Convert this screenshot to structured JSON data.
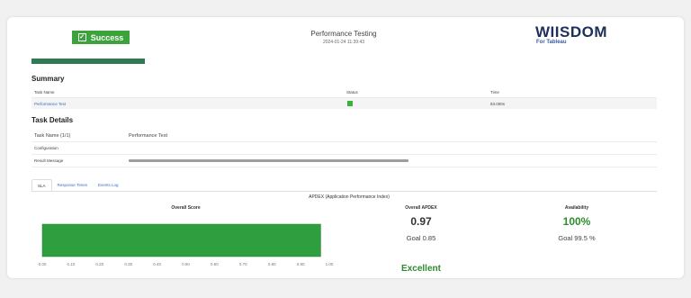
{
  "header": {
    "status_label": "Success",
    "title": "Performance Testing",
    "timestamp": "2024-01-24 11:39:43",
    "logo_main": "WIISDOM",
    "logo_sub": "For Tableau"
  },
  "summary": {
    "title": "Summary",
    "columns": [
      "Task Name",
      "Status",
      "Time"
    ],
    "row": {
      "task_name": "Performance Test",
      "status": "success",
      "time": "83.000s"
    }
  },
  "task_details": {
    "title": "Task Details",
    "task_name_label": "Task Name (1/1)",
    "task_name_value": "Performance Test",
    "configuration_label": "Configuration",
    "result_message_label": "Result Message"
  },
  "tabs": [
    {
      "label": "SLA",
      "active": true
    },
    {
      "label": "Response Times",
      "active": false
    },
    {
      "label": "Events Log",
      "active": false
    }
  ],
  "apdex": {
    "title": "APDEX (Application Performance Index)",
    "overall_apdex_label": "Overall APDEX",
    "overall_apdex_value": "0.97",
    "goal": "Goal 0.85",
    "rating": "Excellent",
    "availability_label": "Availability",
    "availability_value": "100%",
    "availability_goal": "Goal 99.5 %"
  },
  "chart_data": {
    "type": "bar",
    "orientation": "horizontal",
    "title": "Overall Score",
    "categories": [
      ""
    ],
    "values": [
      0.97
    ],
    "xlim": [
      0,
      1.0
    ],
    "xticks": [
      "0.00",
      "0.10",
      "0.20",
      "0.30",
      "0.40",
      "0.50",
      "0.60",
      "0.70",
      "0.80",
      "0.90",
      "1.00"
    ],
    "bar_color": "#2e9e3e",
    "grid": false
  }
}
